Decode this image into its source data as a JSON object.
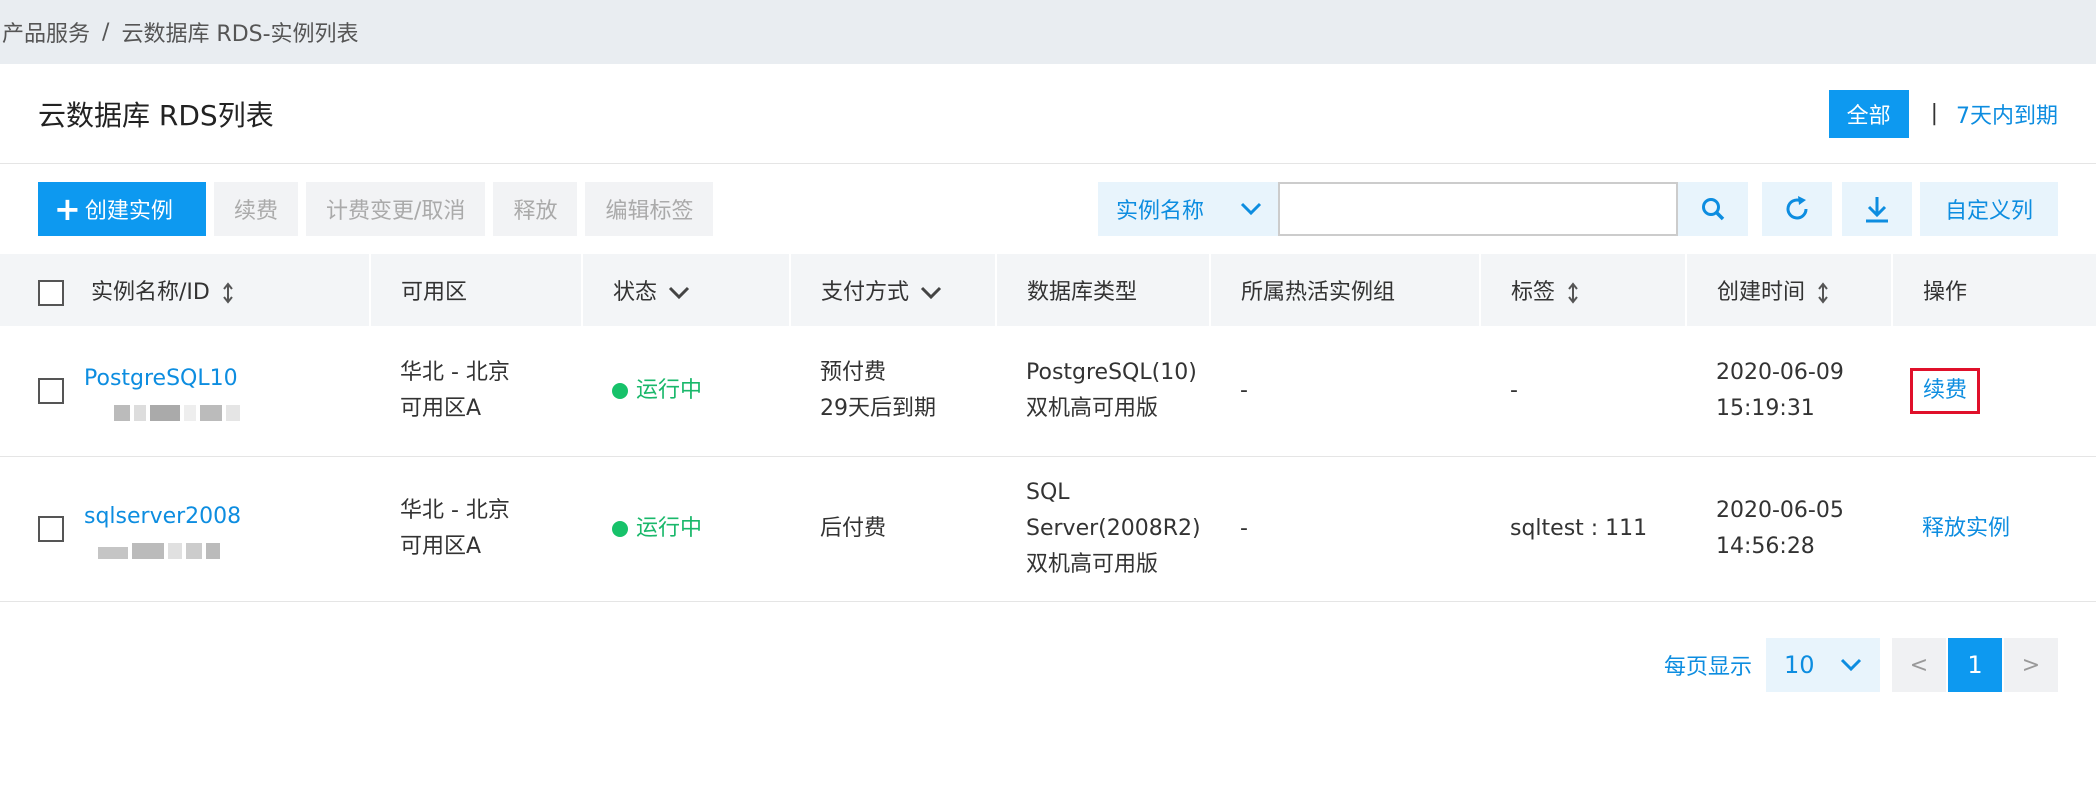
{
  "breadcrumb": {
    "root": "产品服务",
    "separator": "/",
    "current": "云数据库 RDS-实例列表"
  },
  "header": {
    "title": "云数据库 RDS列表",
    "filter_all": "全部",
    "filter_sep": "|",
    "filter_expire": "7天内到期"
  },
  "toolbar": {
    "create": "创建实例",
    "renew": "续费",
    "billing_change": "计费变更/取消",
    "release": "释放",
    "edit_tags": "编辑标签",
    "search_field": "实例名称",
    "search_placeholder": "",
    "custom_columns": "自定义列"
  },
  "table": {
    "headers": {
      "name": "实例名称/ID",
      "zone": "可用区",
      "status": "状态",
      "payment": "支付方式",
      "db_type": "数据库类型",
      "hot_group": "所属热活实例组",
      "tags": "标签",
      "created": "创建时间",
      "actions": "操作"
    },
    "rows": [
      {
        "name": "PostgreSQL10",
        "zone_line1": "华北 - 北京",
        "zone_line2": "可用区A",
        "status": "运行中",
        "payment_line1": "预付费",
        "payment_line2": "29天后到期",
        "db_line1": "PostgreSQL(10)",
        "db_line2": "双机高可用版",
        "db_line3": "",
        "hot_group": "-",
        "tags": "-",
        "created_date": "2020-06-09",
        "created_time": "15:19:31",
        "action": "续费"
      },
      {
        "name": "sqlserver2008",
        "zone_line1": "华北 - 北京",
        "zone_line2": "可用区A",
        "status": "运行中",
        "payment_line1": "后付费",
        "payment_line2": "",
        "db_line1": "SQL",
        "db_line2": "Server(2008R2)",
        "db_line3": "双机高可用版",
        "hot_group": "-",
        "tags": "sqltest : 111",
        "created_date": "2020-06-05",
        "created_time": "14:56:28",
        "action": "释放实例"
      }
    ]
  },
  "pagination": {
    "label": "每页显示",
    "page_size": "10",
    "prev": "<",
    "current": "1",
    "next": ">"
  },
  "colors": {
    "accent": "#0d99f0",
    "link": "#0d8de0",
    "running": "#1ab86b",
    "highlight": "#e0102a"
  },
  "icons": [
    "plus-icon",
    "chevron-down-icon",
    "search-icon",
    "refresh-icon",
    "download-icon",
    "sort-icon"
  ]
}
